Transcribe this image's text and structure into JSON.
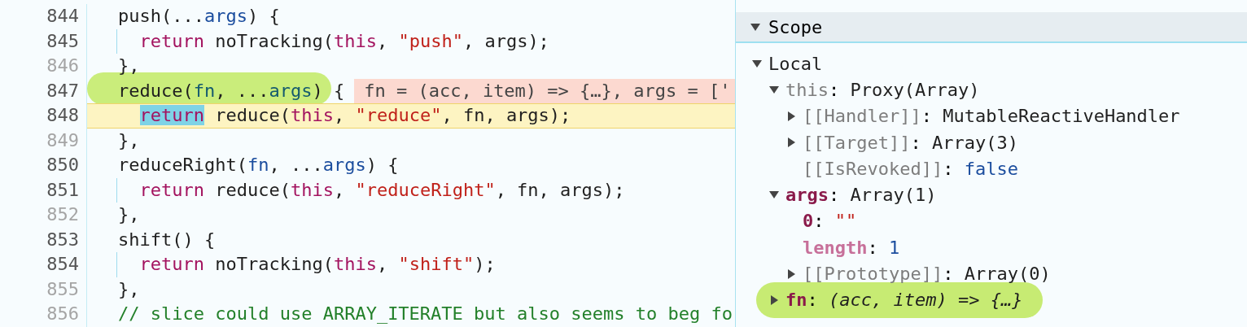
{
  "editor": {
    "lines": [
      {
        "number": "844",
        "muted": false,
        "paused": false,
        "annotated": false,
        "indented": false,
        "tokens": [
          {
            "kind": "plain",
            "text": "push(..."
          },
          {
            "kind": "param",
            "text": "args"
          },
          {
            "kind": "plain",
            "text": ") {"
          }
        ]
      },
      {
        "number": "845",
        "muted": false,
        "paused": false,
        "annotated": false,
        "indented": true,
        "tokens": [
          {
            "kind": "keyword",
            "text": "return"
          },
          {
            "kind": "plain",
            "text": " noTracking("
          },
          {
            "kind": "keyword",
            "text": "this"
          },
          {
            "kind": "plain",
            "text": ", "
          },
          {
            "kind": "string",
            "text": "\"push\""
          },
          {
            "kind": "plain",
            "text": ", args);"
          }
        ]
      },
      {
        "number": "846",
        "muted": true,
        "paused": false,
        "annotated": false,
        "indented": false,
        "tokens": [
          {
            "kind": "plain",
            "text": "},"
          }
        ]
      },
      {
        "number": "847",
        "muted": false,
        "paused": false,
        "annotated": true,
        "indented": false,
        "tokens": [
          {
            "kind": "plain",
            "text": "reduce("
          },
          {
            "kind": "local",
            "text": "fn"
          },
          {
            "kind": "plain",
            "text": ", ..."
          },
          {
            "kind": "local",
            "text": "args"
          },
          {
            "kind": "plain",
            "text": ") {"
          }
        ],
        "inline_value": "fn = (acc, item) => {…}, args = ['"
      },
      {
        "number": "848",
        "muted": false,
        "paused": true,
        "annotated": false,
        "indented": true,
        "tokens": [
          {
            "kind": "keyword",
            "text": "return",
            "current": true
          },
          {
            "kind": "plain",
            "text": " reduce(",
            "current": false
          },
          {
            "kind": "keyword",
            "text": "this",
            "current": false
          },
          {
            "kind": "plain",
            "text": ", ",
            "current": false
          },
          {
            "kind": "string",
            "text": "\"reduce\"",
            "current": false
          },
          {
            "kind": "plain",
            "text": ", fn, args);",
            "current": false
          }
        ]
      },
      {
        "number": "849",
        "muted": true,
        "paused": false,
        "annotated": false,
        "indented": false,
        "tokens": [
          {
            "kind": "plain",
            "text": "},"
          }
        ]
      },
      {
        "number": "850",
        "muted": false,
        "paused": false,
        "annotated": false,
        "indented": false,
        "tokens": [
          {
            "kind": "plain",
            "text": "reduceRight("
          },
          {
            "kind": "param",
            "text": "fn"
          },
          {
            "kind": "plain",
            "text": ", ..."
          },
          {
            "kind": "param",
            "text": "args"
          },
          {
            "kind": "plain",
            "text": ") {"
          }
        ]
      },
      {
        "number": "851",
        "muted": false,
        "paused": false,
        "annotated": false,
        "indented": true,
        "tokens": [
          {
            "kind": "keyword",
            "text": "return"
          },
          {
            "kind": "plain",
            "text": " reduce("
          },
          {
            "kind": "keyword",
            "text": "this"
          },
          {
            "kind": "plain",
            "text": ", "
          },
          {
            "kind": "string",
            "text": "\"reduceRight\""
          },
          {
            "kind": "plain",
            "text": ", fn, args);"
          }
        ]
      },
      {
        "number": "852",
        "muted": true,
        "paused": false,
        "annotated": false,
        "indented": false,
        "tokens": [
          {
            "kind": "plain",
            "text": "},"
          }
        ]
      },
      {
        "number": "853",
        "muted": false,
        "paused": false,
        "annotated": false,
        "indented": false,
        "tokens": [
          {
            "kind": "plain",
            "text": "shift() {"
          }
        ]
      },
      {
        "number": "854",
        "muted": false,
        "paused": false,
        "annotated": false,
        "indented": true,
        "tokens": [
          {
            "kind": "keyword",
            "text": "return"
          },
          {
            "kind": "plain",
            "text": " noTracking("
          },
          {
            "kind": "keyword",
            "text": "this"
          },
          {
            "kind": "plain",
            "text": ", "
          },
          {
            "kind": "string",
            "text": "\"shift\""
          },
          {
            "kind": "plain",
            "text": ");"
          }
        ]
      },
      {
        "number": "855",
        "muted": true,
        "paused": false,
        "annotated": false,
        "indented": false,
        "tokens": [
          {
            "kind": "plain",
            "text": "},"
          }
        ]
      },
      {
        "number": "856",
        "muted": true,
        "paused": false,
        "annotated": false,
        "indented": false,
        "tokens": [
          {
            "kind": "comment",
            "text": "// slice could use ARRAY_ITERATE but also seems to beg fo"
          }
        ]
      }
    ]
  },
  "scope": {
    "title": "Scope",
    "expanded": true,
    "items": [
      {
        "name": {
          "kind": "section",
          "text": "Local"
        },
        "expanded": true,
        "annotated": false,
        "children": [
          {
            "name": {
              "kind": "dim",
              "text": "this"
            },
            "separator": ":",
            "value": {
              "kind": "object",
              "text": "Proxy(Array)"
            },
            "expanded": true,
            "annotated": false,
            "children": [
              {
                "name": {
                  "kind": "dim",
                  "text": "[[Handler]]"
                },
                "separator": ":",
                "value": {
                  "kind": "object",
                  "text": "MutableReactiveHandler"
                },
                "expanded": false,
                "annotated": false
              },
              {
                "name": {
                  "kind": "dim",
                  "text": "[[Target]]"
                },
                "separator": ":",
                "value": {
                  "kind": "object",
                  "text": "Array(3)"
                },
                "expanded": false,
                "annotated": false
              },
              {
                "name": {
                  "kind": "dim",
                  "text": "[[IsRevoked]]"
                },
                "separator": ":",
                "value": {
                  "kind": "boolean",
                  "text": "false"
                },
                "annotated": false
              }
            ]
          },
          {
            "name": {
              "kind": "own",
              "text": "args"
            },
            "separator": ":",
            "value": {
              "kind": "object",
              "text": "Array(1)"
            },
            "expanded": true,
            "annotated": false,
            "children": [
              {
                "name": {
                  "kind": "own",
                  "text": "0"
                },
                "separator": ":",
                "value": {
                  "kind": "string",
                  "text": "\"\""
                },
                "annotated": false
              },
              {
                "name": {
                  "kind": "hidden",
                  "text": "length"
                },
                "separator": ":",
                "value": {
                  "kind": "number",
                  "text": "1"
                },
                "annotated": false
              },
              {
                "name": {
                  "kind": "dim",
                  "text": "[[Prototype]]"
                },
                "separator": ":",
                "value": {
                  "kind": "object",
                  "text": "Array(0)"
                },
                "expanded": false,
                "annotated": false
              }
            ]
          },
          {
            "name": {
              "kind": "own",
              "text": "fn"
            },
            "separator": ":",
            "value": {
              "kind": "function",
              "text": "(acc, item) => {…}"
            },
            "expanded": false,
            "annotated": true
          }
        ]
      }
    ]
  }
}
